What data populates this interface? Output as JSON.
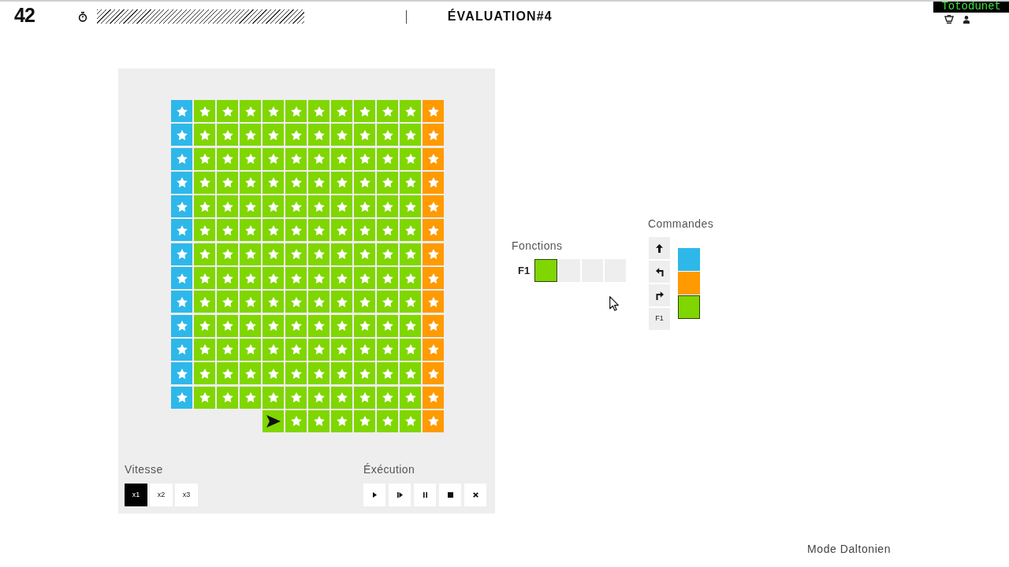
{
  "header": {
    "logo": "42",
    "title": "ÉVALUATION#4",
    "user": "Totodunet"
  },
  "board": {
    "rows": [
      [
        {
          "kind": "tile",
          "color": "#2eb8ea",
          "star": true
        },
        {
          "kind": "tile",
          "color": "#80d600",
          "star": true
        },
        {
          "kind": "tile",
          "color": "#80d600",
          "star": true
        },
        {
          "kind": "tile",
          "color": "#80d600",
          "star": true
        },
        {
          "kind": "tile",
          "color": "#80d600",
          "star": true
        },
        {
          "kind": "tile",
          "color": "#80d600",
          "star": true
        },
        {
          "kind": "tile",
          "color": "#80d600",
          "star": true
        },
        {
          "kind": "tile",
          "color": "#80d600",
          "star": true
        },
        {
          "kind": "tile",
          "color": "#80d600",
          "star": true
        },
        {
          "kind": "tile",
          "color": "#80d600",
          "star": true
        },
        {
          "kind": "tile",
          "color": "#80d600",
          "star": true
        },
        {
          "kind": "tile",
          "color": "#ff9a00",
          "star": true
        }
      ],
      [
        {
          "kind": "tile",
          "color": "#2eb8ea",
          "star": true
        },
        {
          "kind": "tile",
          "color": "#80d600",
          "star": true
        },
        {
          "kind": "tile",
          "color": "#80d600",
          "star": true
        },
        {
          "kind": "tile",
          "color": "#80d600",
          "star": true
        },
        {
          "kind": "tile",
          "color": "#80d600",
          "star": true
        },
        {
          "kind": "tile",
          "color": "#80d600",
          "star": true
        },
        {
          "kind": "tile",
          "color": "#80d600",
          "star": true
        },
        {
          "kind": "tile",
          "color": "#80d600",
          "star": true
        },
        {
          "kind": "tile",
          "color": "#80d600",
          "star": true
        },
        {
          "kind": "tile",
          "color": "#80d600",
          "star": true
        },
        {
          "kind": "tile",
          "color": "#80d600",
          "star": true
        },
        {
          "kind": "tile",
          "color": "#ff9a00",
          "star": true
        }
      ],
      [
        {
          "kind": "tile",
          "color": "#2eb8ea",
          "star": true
        },
        {
          "kind": "tile",
          "color": "#80d600",
          "star": true
        },
        {
          "kind": "tile",
          "color": "#80d600",
          "star": true
        },
        {
          "kind": "tile",
          "color": "#80d600",
          "star": true
        },
        {
          "kind": "tile",
          "color": "#80d600",
          "star": true
        },
        {
          "kind": "tile",
          "color": "#80d600",
          "star": true
        },
        {
          "kind": "tile",
          "color": "#80d600",
          "star": true
        },
        {
          "kind": "tile",
          "color": "#80d600",
          "star": true
        },
        {
          "kind": "tile",
          "color": "#80d600",
          "star": true
        },
        {
          "kind": "tile",
          "color": "#80d600",
          "star": true
        },
        {
          "kind": "tile",
          "color": "#80d600",
          "star": true
        },
        {
          "kind": "tile",
          "color": "#ff9a00",
          "star": true
        }
      ],
      [
        {
          "kind": "tile",
          "color": "#2eb8ea",
          "star": true
        },
        {
          "kind": "tile",
          "color": "#80d600",
          "star": true
        },
        {
          "kind": "tile",
          "color": "#80d600",
          "star": true
        },
        {
          "kind": "tile",
          "color": "#80d600",
          "star": true
        },
        {
          "kind": "tile",
          "color": "#80d600",
          "star": true
        },
        {
          "kind": "tile",
          "color": "#80d600",
          "star": true
        },
        {
          "kind": "tile",
          "color": "#80d600",
          "star": true
        },
        {
          "kind": "tile",
          "color": "#80d600",
          "star": true
        },
        {
          "kind": "tile",
          "color": "#80d600",
          "star": true
        },
        {
          "kind": "tile",
          "color": "#80d600",
          "star": true
        },
        {
          "kind": "tile",
          "color": "#80d600",
          "star": true
        },
        {
          "kind": "tile",
          "color": "#ff9a00",
          "star": true
        }
      ],
      [
        {
          "kind": "tile",
          "color": "#2eb8ea",
          "star": true
        },
        {
          "kind": "tile",
          "color": "#80d600",
          "star": true
        },
        {
          "kind": "tile",
          "color": "#80d600",
          "star": true
        },
        {
          "kind": "tile",
          "color": "#80d600",
          "star": true
        },
        {
          "kind": "tile",
          "color": "#80d600",
          "star": true
        },
        {
          "kind": "tile",
          "color": "#80d600",
          "star": true
        },
        {
          "kind": "tile",
          "color": "#80d600",
          "star": true
        },
        {
          "kind": "tile",
          "color": "#80d600",
          "star": true
        },
        {
          "kind": "tile",
          "color": "#80d600",
          "star": true
        },
        {
          "kind": "tile",
          "color": "#80d600",
          "star": true
        },
        {
          "kind": "tile",
          "color": "#80d600",
          "star": true
        },
        {
          "kind": "tile",
          "color": "#ff9a00",
          "star": true
        }
      ],
      [
        {
          "kind": "tile",
          "color": "#2eb8ea",
          "star": true
        },
        {
          "kind": "tile",
          "color": "#80d600",
          "star": true
        },
        {
          "kind": "tile",
          "color": "#80d600",
          "star": true
        },
        {
          "kind": "tile",
          "color": "#80d600",
          "star": true
        },
        {
          "kind": "tile",
          "color": "#80d600",
          "star": true
        },
        {
          "kind": "tile",
          "color": "#80d600",
          "star": true
        },
        {
          "kind": "tile",
          "color": "#80d600",
          "star": true
        },
        {
          "kind": "tile",
          "color": "#80d600",
          "star": true
        },
        {
          "kind": "tile",
          "color": "#80d600",
          "star": true
        },
        {
          "kind": "tile",
          "color": "#80d600",
          "star": true
        },
        {
          "kind": "tile",
          "color": "#80d600",
          "star": true
        },
        {
          "kind": "tile",
          "color": "#ff9a00",
          "star": true
        }
      ],
      [
        {
          "kind": "tile",
          "color": "#2eb8ea",
          "star": true
        },
        {
          "kind": "tile",
          "color": "#80d600",
          "star": true
        },
        {
          "kind": "tile",
          "color": "#80d600",
          "star": true
        },
        {
          "kind": "tile",
          "color": "#80d600",
          "star": true
        },
        {
          "kind": "tile",
          "color": "#80d600",
          "star": true
        },
        {
          "kind": "tile",
          "color": "#80d600",
          "star": true
        },
        {
          "kind": "tile",
          "color": "#80d600",
          "star": true
        },
        {
          "kind": "tile",
          "color": "#80d600",
          "star": true
        },
        {
          "kind": "tile",
          "color": "#80d600",
          "star": true
        },
        {
          "kind": "tile",
          "color": "#80d600",
          "star": true
        },
        {
          "kind": "tile",
          "color": "#80d600",
          "star": true
        },
        {
          "kind": "tile",
          "color": "#ff9a00",
          "star": true
        }
      ],
      [
        {
          "kind": "tile",
          "color": "#2eb8ea",
          "star": true
        },
        {
          "kind": "tile",
          "color": "#80d600",
          "star": true
        },
        {
          "kind": "tile",
          "color": "#80d600",
          "star": true
        },
        {
          "kind": "tile",
          "color": "#80d600",
          "star": true
        },
        {
          "kind": "tile",
          "color": "#80d600",
          "star": true
        },
        {
          "kind": "tile",
          "color": "#80d600",
          "star": true
        },
        {
          "kind": "tile",
          "color": "#80d600",
          "star": true
        },
        {
          "kind": "tile",
          "color": "#80d600",
          "star": true
        },
        {
          "kind": "tile",
          "color": "#80d600",
          "star": true
        },
        {
          "kind": "tile",
          "color": "#80d600",
          "star": true
        },
        {
          "kind": "tile",
          "color": "#80d600",
          "star": true
        },
        {
          "kind": "tile",
          "color": "#ff9a00",
          "star": true
        }
      ],
      [
        {
          "kind": "tile",
          "color": "#2eb8ea",
          "star": true
        },
        {
          "kind": "tile",
          "color": "#80d600",
          "star": true
        },
        {
          "kind": "tile",
          "color": "#80d600",
          "star": true
        },
        {
          "kind": "tile",
          "color": "#80d600",
          "star": true
        },
        {
          "kind": "tile",
          "color": "#80d600",
          "star": true
        },
        {
          "kind": "tile",
          "color": "#80d600",
          "star": true
        },
        {
          "kind": "tile",
          "color": "#80d600",
          "star": true
        },
        {
          "kind": "tile",
          "color": "#80d600",
          "star": true
        },
        {
          "kind": "tile",
          "color": "#80d600",
          "star": true
        },
        {
          "kind": "tile",
          "color": "#80d600",
          "star": true
        },
        {
          "kind": "tile",
          "color": "#80d600",
          "star": true
        },
        {
          "kind": "tile",
          "color": "#ff9a00",
          "star": true
        }
      ],
      [
        {
          "kind": "tile",
          "color": "#2eb8ea",
          "star": true
        },
        {
          "kind": "tile",
          "color": "#80d600",
          "star": true
        },
        {
          "kind": "tile",
          "color": "#80d600",
          "star": true
        },
        {
          "kind": "tile",
          "color": "#80d600",
          "star": true
        },
        {
          "kind": "tile",
          "color": "#80d600",
          "star": true
        },
        {
          "kind": "tile",
          "color": "#80d600",
          "star": true
        },
        {
          "kind": "tile",
          "color": "#80d600",
          "star": true
        },
        {
          "kind": "tile",
          "color": "#80d600",
          "star": true
        },
        {
          "kind": "tile",
          "color": "#80d600",
          "star": true
        },
        {
          "kind": "tile",
          "color": "#80d600",
          "star": true
        },
        {
          "kind": "tile",
          "color": "#80d600",
          "star": true
        },
        {
          "kind": "tile",
          "color": "#ff9a00",
          "star": true
        }
      ],
      [
        {
          "kind": "tile",
          "color": "#2eb8ea",
          "star": true
        },
        {
          "kind": "tile",
          "color": "#80d600",
          "star": true
        },
        {
          "kind": "tile",
          "color": "#80d600",
          "star": true
        },
        {
          "kind": "tile",
          "color": "#80d600",
          "star": true
        },
        {
          "kind": "tile",
          "color": "#80d600",
          "star": true
        },
        {
          "kind": "tile",
          "color": "#80d600",
          "star": true
        },
        {
          "kind": "tile",
          "color": "#80d600",
          "star": true
        },
        {
          "kind": "tile",
          "color": "#80d600",
          "star": true
        },
        {
          "kind": "tile",
          "color": "#80d600",
          "star": true
        },
        {
          "kind": "tile",
          "color": "#80d600",
          "star": true
        },
        {
          "kind": "tile",
          "color": "#80d600",
          "star": true
        },
        {
          "kind": "tile",
          "color": "#ff9a00",
          "star": true
        }
      ],
      [
        {
          "kind": "tile",
          "color": "#2eb8ea",
          "star": true
        },
        {
          "kind": "tile",
          "color": "#80d600",
          "star": true
        },
        {
          "kind": "tile",
          "color": "#80d600",
          "star": true
        },
        {
          "kind": "tile",
          "color": "#80d600",
          "star": true
        },
        {
          "kind": "tile",
          "color": "#80d600",
          "star": true
        },
        {
          "kind": "tile",
          "color": "#80d600",
          "star": true
        },
        {
          "kind": "tile",
          "color": "#80d600",
          "star": true
        },
        {
          "kind": "tile",
          "color": "#80d600",
          "star": true
        },
        {
          "kind": "tile",
          "color": "#80d600",
          "star": true
        },
        {
          "kind": "tile",
          "color": "#80d600",
          "star": true
        },
        {
          "kind": "tile",
          "color": "#80d600",
          "star": true
        },
        {
          "kind": "tile",
          "color": "#ff9a00",
          "star": true
        }
      ],
      [
        {
          "kind": "tile",
          "color": "#2eb8ea",
          "star": true
        },
        {
          "kind": "tile",
          "color": "#80d600",
          "star": true
        },
        {
          "kind": "tile",
          "color": "#80d600",
          "star": true
        },
        {
          "kind": "tile",
          "color": "#80d600",
          "star": true
        },
        {
          "kind": "tile",
          "color": "#80d600",
          "star": true
        },
        {
          "kind": "tile",
          "color": "#80d600",
          "star": true
        },
        {
          "kind": "tile",
          "color": "#80d600",
          "star": true
        },
        {
          "kind": "tile",
          "color": "#80d600",
          "star": true
        },
        {
          "kind": "tile",
          "color": "#80d600",
          "star": true
        },
        {
          "kind": "tile",
          "color": "#80d600",
          "star": true
        },
        {
          "kind": "tile",
          "color": "#80d600",
          "star": true
        },
        {
          "kind": "tile",
          "color": "#ff9a00",
          "star": true
        }
      ],
      [
        {
          "kind": "empty"
        },
        {
          "kind": "empty"
        },
        {
          "kind": "empty"
        },
        {
          "kind": "empty"
        },
        {
          "kind": "tile",
          "color": "#80d600",
          "star": false,
          "robot": true
        },
        {
          "kind": "tile",
          "color": "#80d600",
          "star": true
        },
        {
          "kind": "tile",
          "color": "#80d600",
          "star": true
        },
        {
          "kind": "tile",
          "color": "#80d600",
          "star": true
        },
        {
          "kind": "tile",
          "color": "#80d600",
          "star": true
        },
        {
          "kind": "tile",
          "color": "#80d600",
          "star": true
        },
        {
          "kind": "tile",
          "color": "#80d600",
          "star": true
        },
        {
          "kind": "tile",
          "color": "#ff9a00",
          "star": true
        }
      ]
    ]
  },
  "speed": {
    "label": "Vitesse",
    "options": [
      {
        "label": "x1",
        "selected": true
      },
      {
        "label": "x2",
        "selected": false
      },
      {
        "label": "x3",
        "selected": false
      }
    ]
  },
  "execution": {
    "label": "Éxécution",
    "buttons": [
      {
        "kind": "play"
      },
      {
        "kind": "step"
      },
      {
        "kind": "pause"
      },
      {
        "kind": "stop"
      },
      {
        "kind": "clear"
      }
    ]
  },
  "functions": {
    "label": "Fonctions",
    "items": [
      {
        "name": "F1",
        "slots": [
          {
            "kind": "color",
            "color": "#80d600"
          },
          {
            "kind": "empty"
          },
          {
            "kind": "empty"
          },
          {
            "kind": "empty"
          }
        ]
      }
    ]
  },
  "commands": {
    "label": "Commandes",
    "actions": [
      {
        "kind": "forward"
      },
      {
        "kind": "turn_left"
      },
      {
        "kind": "turn_right"
      },
      {
        "kind": "function",
        "label": "F1"
      }
    ],
    "colors": [
      {
        "color": "#2eb8ea",
        "selected": false
      },
      {
        "color": "#ff9a00",
        "selected": false
      },
      {
        "color": "#80d600",
        "selected": true
      }
    ]
  },
  "footer": {
    "colorblind_mode": "Mode Daltonien"
  }
}
